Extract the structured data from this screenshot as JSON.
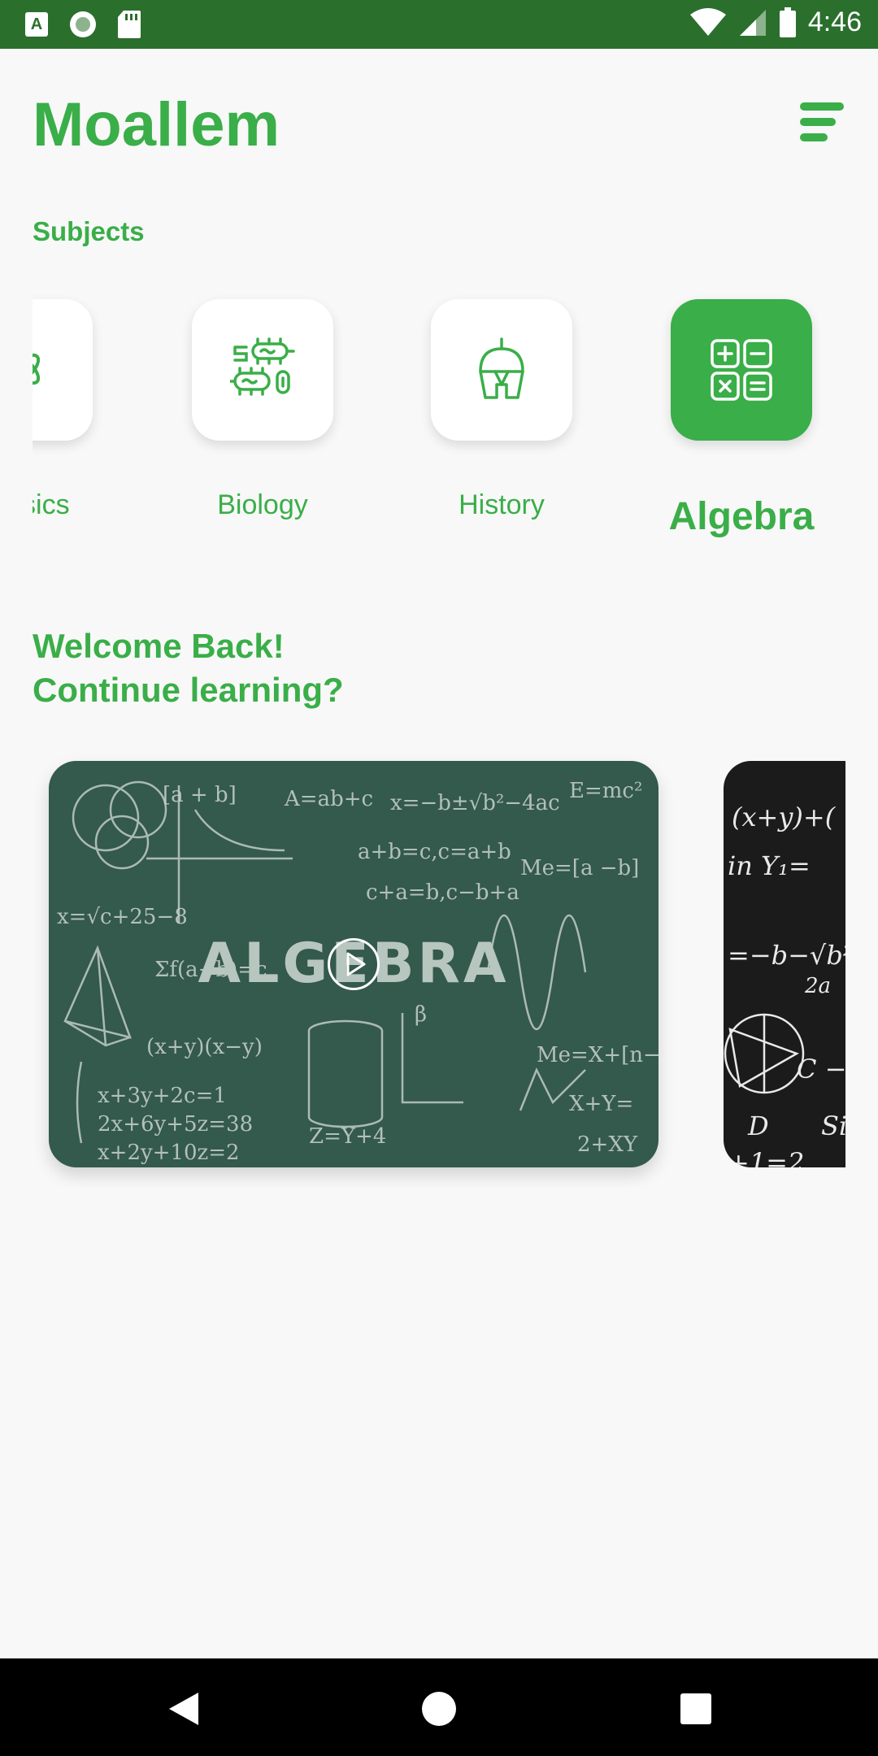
{
  "status_bar": {
    "time": "4:46",
    "left_icons": [
      "font-a-icon",
      "record-icon",
      "sd-card-icon"
    ],
    "right_icons": [
      "wifi-icon",
      "signal-icon",
      "battery-icon"
    ],
    "background_color": "#2b6f2d"
  },
  "header": {
    "app_title": "Moallem",
    "menu_icon": "sort-menu-icon"
  },
  "subjects": {
    "section_label": "Subjects",
    "items": [
      {
        "label": "Physics",
        "icon": "atom-icon",
        "active": false
      },
      {
        "label": "Biology",
        "icon": "bacteria-icon",
        "active": false
      },
      {
        "label": "History",
        "icon": "helmet-icon",
        "active": false
      },
      {
        "label": "Algebra",
        "icon": "calculator-icon",
        "active": true
      }
    ]
  },
  "welcome": {
    "line1": "Welcome Back!",
    "line2": "Continue learning?"
  },
  "lessons": [
    {
      "title": "ALGEBRA",
      "thumbnail": "chalkboard-green",
      "has_play": true
    },
    {
      "title": "",
      "thumbnail": "chalkboard-black",
      "has_play": false
    }
  ],
  "nav_bar": {
    "buttons": [
      "back-icon",
      "home-icon",
      "recents-icon"
    ]
  },
  "colors": {
    "accent": "#3aae48",
    "status_bar": "#2b6f2d",
    "background": "#f8f8f8"
  }
}
